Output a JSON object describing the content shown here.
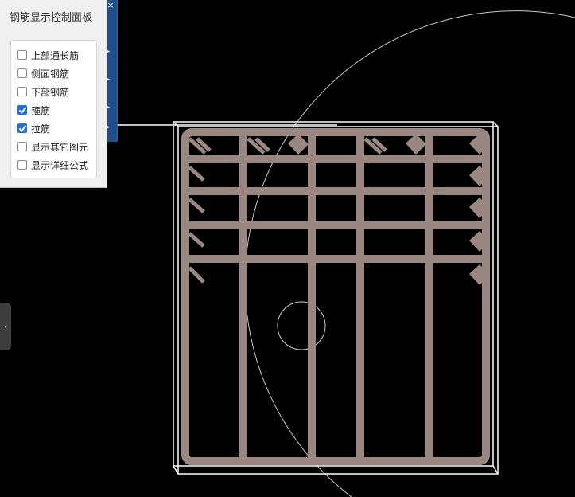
{
  "panel": {
    "title": "钢筋显示控制面板",
    "options": [
      {
        "label": "上部通长筋",
        "checked": false
      },
      {
        "label": "侧面钢筋",
        "checked": false
      },
      {
        "label": "下部钢筋",
        "checked": false
      },
      {
        "label": "箍筋",
        "checked": true
      },
      {
        "label": "拉筋",
        "checked": true
      },
      {
        "label": "显示其它图元",
        "checked": false
      },
      {
        "label": "显示详细公式",
        "checked": false
      }
    ]
  },
  "toolbar": {
    "close_glyph": "×",
    "arrow_glyph": "‹"
  },
  "colors": {
    "background": "#000000",
    "rebar": "#9a8781",
    "outline": "#ffffff",
    "arc": "#c8c8c8",
    "checkbox_checked": "#1f6fd6"
  }
}
